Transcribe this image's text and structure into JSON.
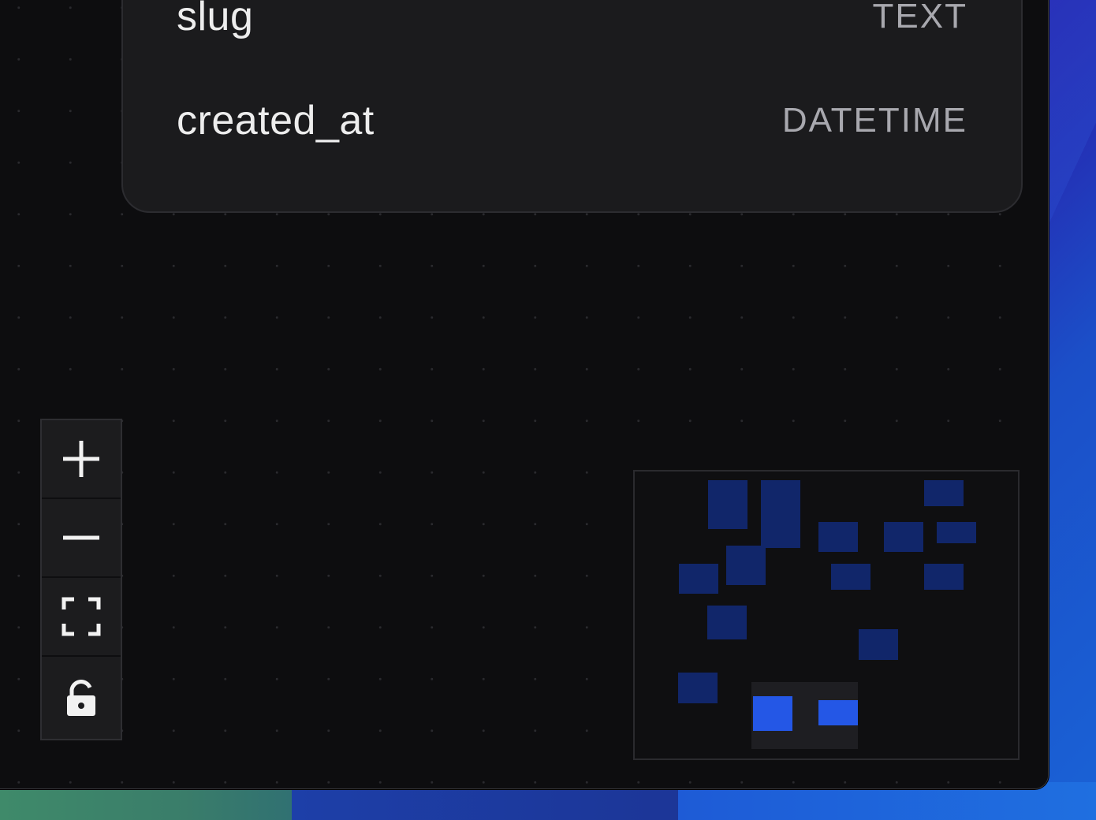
{
  "table": {
    "columns": [
      {
        "name": "slug",
        "type": "TEXT"
      },
      {
        "name": "created_at",
        "type": "DATETIME"
      }
    ]
  },
  "controls": {
    "items": [
      {
        "icon": "plus-icon",
        "action": "zoom-in"
      },
      {
        "icon": "minus-icon",
        "action": "zoom-out"
      },
      {
        "icon": "fit-view-icon",
        "action": "fit-view"
      },
      {
        "icon": "unlock-icon",
        "action": "toggle-interactivity"
      }
    ]
  },
  "colors": {
    "canvas_bg": "#0d0d0f",
    "card_bg": "#1b1b1d",
    "minimap_node": "#11266a",
    "minimap_node_active": "#2457e6"
  }
}
